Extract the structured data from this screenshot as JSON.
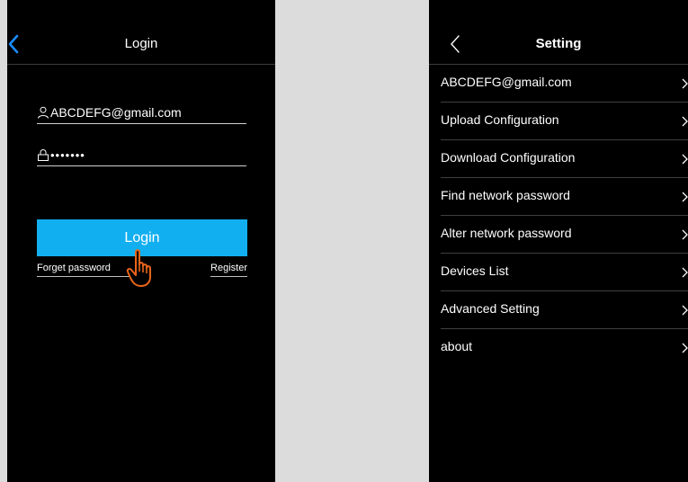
{
  "login": {
    "title": "Login",
    "email_value": "ABCDEFG@gmail.com",
    "password_value": "•••••••",
    "login_label": "Login",
    "forget_label": "Forget password",
    "register_label": "Register"
  },
  "settings": {
    "title": "Setting",
    "items": [
      {
        "label": "ABCDEFG@gmail.com"
      },
      {
        "label": "Upload Configuration"
      },
      {
        "label": "Download Configuration"
      },
      {
        "label": "Find network password"
      },
      {
        "label": "Alter network password"
      },
      {
        "label": "Devices List"
      },
      {
        "label": "Advanced Setting"
      },
      {
        "label": "about"
      }
    ]
  },
  "colors": {
    "accent": "#12aff0",
    "back_login": "#1a8cff",
    "hand": "#e8641a",
    "background": "#000000",
    "page": "#dcdcdc"
  },
  "icons": [
    "back-chevron-icon",
    "user-icon",
    "lock-icon",
    "hand-pointer-icon",
    "chevron-right-icon"
  ]
}
